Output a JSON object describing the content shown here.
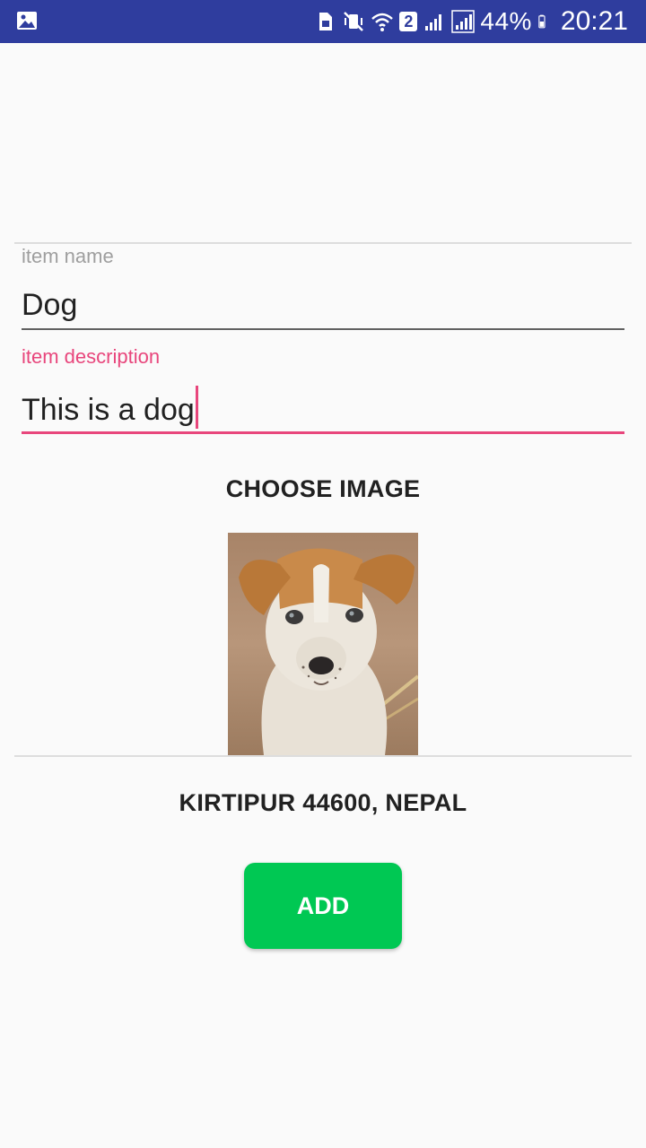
{
  "status_bar": {
    "left_icon": "image-icon",
    "right_icons": [
      "sim-card-icon",
      "vibrate-off-icon",
      "wifi-icon",
      "signal-icon",
      "signal-icon",
      "battery-icon"
    ],
    "sim_number": "2",
    "battery_percent": "44%",
    "time": "20:21"
  },
  "form": {
    "item_name_label": "item name",
    "item_name_value": "Dog",
    "item_description_label": "item description",
    "item_description_value": "This is a dog",
    "choose_image_label": "CHOOSE IMAGE",
    "location_text": "KIRTIPUR 44600, NEPAL",
    "add_label": "ADD"
  },
  "colors": {
    "status_bar": "#2f3d9e",
    "accent": "#e8467c",
    "add_button": "#00c853",
    "background": "#fafafa"
  }
}
